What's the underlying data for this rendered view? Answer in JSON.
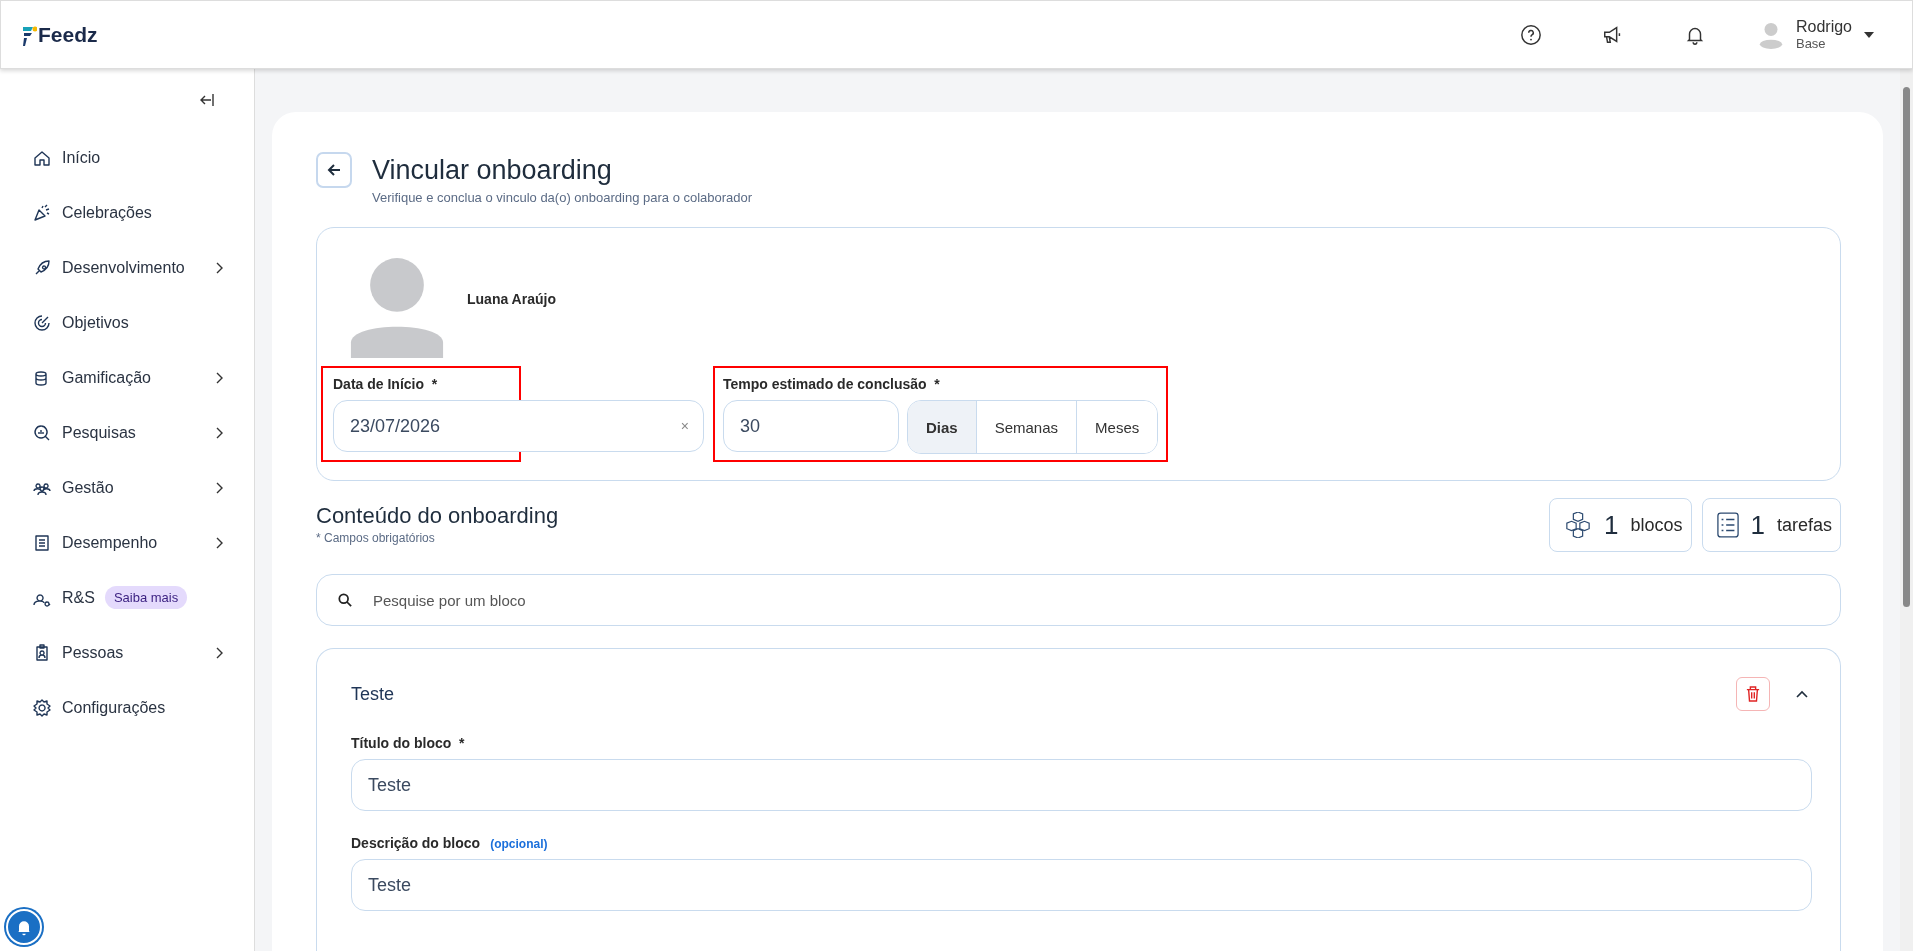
{
  "header": {
    "logo": "Feedz",
    "user": {
      "name": "Rodrigo",
      "role": "Base"
    }
  },
  "sidebar": {
    "items": [
      {
        "label": "Início",
        "expandable": false
      },
      {
        "label": "Celebrações",
        "expandable": false
      },
      {
        "label": "Desenvolvimento",
        "expandable": true
      },
      {
        "label": "Objetivos",
        "expandable": false
      },
      {
        "label": "Gamificação",
        "expandable": true
      },
      {
        "label": "Pesquisas",
        "expandable": true
      },
      {
        "label": "Gestão",
        "expandable": true
      },
      {
        "label": "Desempenho",
        "expandable": true
      },
      {
        "label": "R&S",
        "expandable": false,
        "badge": "Saiba mais"
      },
      {
        "label": "Pessoas",
        "expandable": true
      },
      {
        "label": "Configurações",
        "expandable": false
      }
    ]
  },
  "page": {
    "title": "Vincular onboarding",
    "subtitle": "Verifique e conclua o vinculo da(o) onboarding para o colaborador"
  },
  "employee": {
    "name": "Luana Araújo"
  },
  "start_date": {
    "label": "Data de Início",
    "marker": "*",
    "value": "23/07/2026",
    "clear": "×"
  },
  "duration": {
    "label": "Tempo estimado de conclusão",
    "marker": "*",
    "value": "30",
    "units": [
      {
        "label": "Dias",
        "selected": true
      },
      {
        "label": "Semanas",
        "selected": false
      },
      {
        "label": "Meses",
        "selected": false
      }
    ]
  },
  "content": {
    "title": "Conteúdo do onboarding",
    "note": "* Campos obrigatórios",
    "stats": [
      {
        "count": "1",
        "label": "blocos"
      },
      {
        "count": "1",
        "label": "tarefas"
      }
    ],
    "search": {
      "placeholder": "Pesquise por um bloco"
    },
    "blocks": [
      {
        "title": "Teste",
        "expanded": true,
        "fields": [
          {
            "label": "Título do bloco",
            "marker": "*",
            "value": "Teste"
          },
          {
            "label": "Descrição do bloco",
            "hint": "(opcional)",
            "value": "Teste"
          }
        ]
      }
    ]
  }
}
